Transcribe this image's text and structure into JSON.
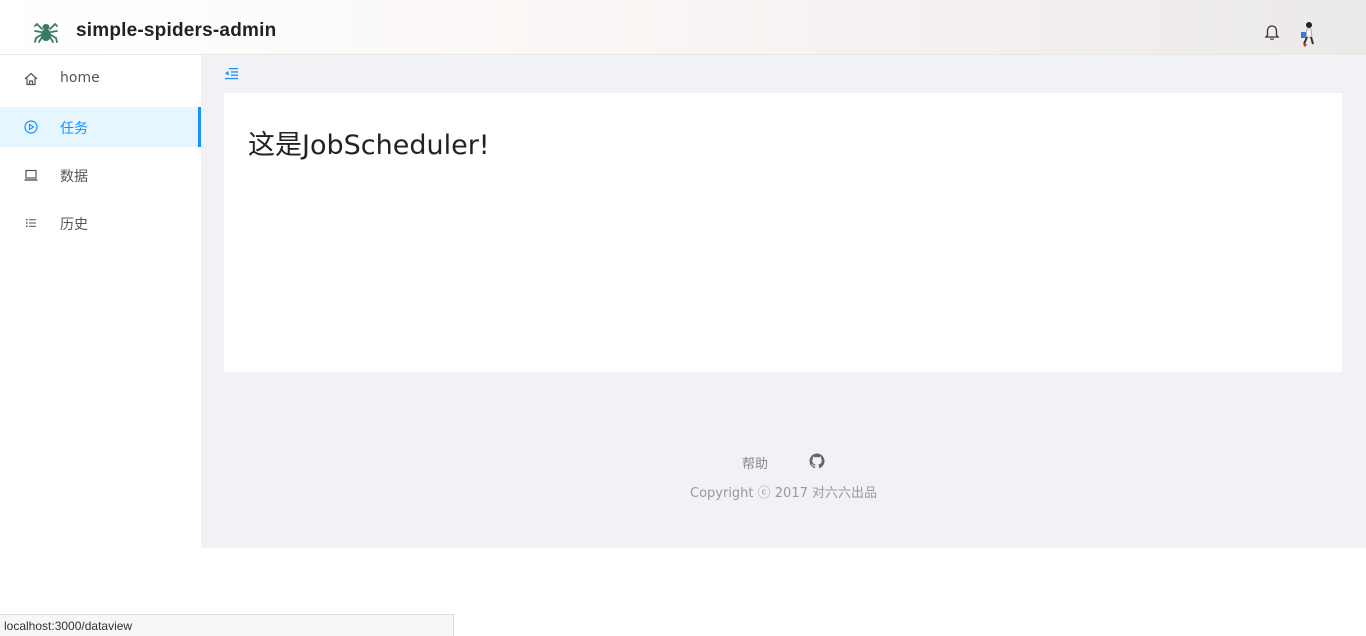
{
  "header": {
    "app_title": "simple-spiders-admin",
    "logo_icon": "spider-icon",
    "notification_icon": "bell-icon",
    "avatar_icon": "user-avatar"
  },
  "sidebar": {
    "items": [
      {
        "label": "home",
        "icon": "home-icon",
        "active": false
      },
      {
        "label": "任务",
        "icon": "play-circle-icon",
        "active": true
      },
      {
        "label": "数据",
        "icon": "laptop-icon",
        "active": false
      },
      {
        "label": "历史",
        "icon": "list-icon",
        "active": false
      }
    ]
  },
  "main": {
    "collapse_icon": "menu-fold-icon",
    "heading": "这是JobScheduler!"
  },
  "footer": {
    "help_label": "帮助",
    "github_icon": "github-icon",
    "copyright": "Copyright ⓒ 2017 对六六出品"
  },
  "status_bar": {
    "url": "localhost:3000/dataview"
  },
  "colors": {
    "accent": "#1890ff",
    "active_bg": "#e6f6ff",
    "content_bg": "#f0f2f5",
    "logo": "#3b7a63"
  }
}
